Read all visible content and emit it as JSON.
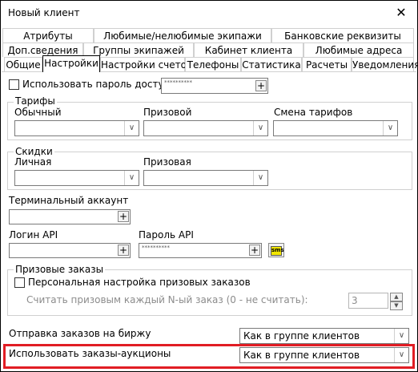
{
  "window": {
    "title": "Новый клиент",
    "close_icon": "close-icon"
  },
  "tabs": {
    "row1": [
      "Атрибуты",
      "Любимые/нелюбимые экипажи",
      "Банковские реквизиты"
    ],
    "row2": [
      "Доп.сведения",
      "Группы экипажей",
      "Кабинет клиента",
      "Любимые адреса"
    ],
    "row3": [
      "Общие",
      "Настройки",
      "Настройки счетов",
      "Телефоны",
      "Статистика",
      "Расчеты",
      "Уведомления"
    ],
    "active": "Настройки"
  },
  "password": {
    "label": "Использовать пароль доступа",
    "checked": false,
    "value": "**********"
  },
  "tariffs": {
    "legend": "Тарифы",
    "regular_label": "Обычный",
    "prize_label": "Призовой",
    "change_label": "Смена тарифов"
  },
  "discounts": {
    "legend": "Скидки",
    "personal_label": "Личная",
    "prize_label": "Призовая"
  },
  "terminal": {
    "label": "Терминальный аккаунт"
  },
  "api": {
    "login_label": "Логин API",
    "password_label": "Пароль API",
    "password_value": "**********",
    "sms_label": "sms"
  },
  "prize_orders": {
    "legend": "Призовые заказы",
    "personal_label": "Персональная настройка призовых заказов",
    "every_n_label": "Считать призовым каждый N-ый заказ (0 - не считать):",
    "every_n_value": "3"
  },
  "exchange": {
    "label": "Отправка заказов на биржу",
    "value": "Как в группе клиентов"
  },
  "auctions": {
    "label": "Использовать заказы-аукционы",
    "value": "Как в группе клиентов"
  }
}
